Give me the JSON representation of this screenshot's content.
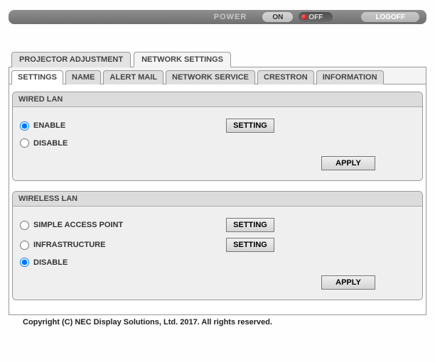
{
  "topbar": {
    "power_label": "POWER",
    "on_label": "ON",
    "off_label": "OFF",
    "logoff_label": "LOGOFF"
  },
  "primary_tabs": {
    "projector_adjustment": "PROJECTOR ADJUSTMENT",
    "network_settings": "NETWORK SETTINGS",
    "active": "network_settings"
  },
  "secondary_tabs": {
    "settings": "SETTINGS",
    "name": "NAME",
    "alert_mail": "ALERT MAIL",
    "network_service": "NETWORK SERVICE",
    "crestron": "CRESTRON",
    "information": "INFORMATION",
    "active": "settings"
  },
  "wired_lan": {
    "title": "WIRED LAN",
    "options": {
      "enable": "ENABLE",
      "disable": "DISABLE"
    },
    "selected": "enable",
    "setting_button": "SETTING",
    "apply_button": "APPLY"
  },
  "wireless_lan": {
    "title": "WIRELESS LAN",
    "options": {
      "simple_ap": "SIMPLE ACCESS POINT",
      "infrastructure": "INFRASTRUCTURE",
      "disable": "DISABLE"
    },
    "selected": "disable",
    "setting_button": "SETTING",
    "apply_button": "APPLY"
  },
  "footer": "Copyright (C) NEC Display Solutions, Ltd. 2017. All rights reserved."
}
